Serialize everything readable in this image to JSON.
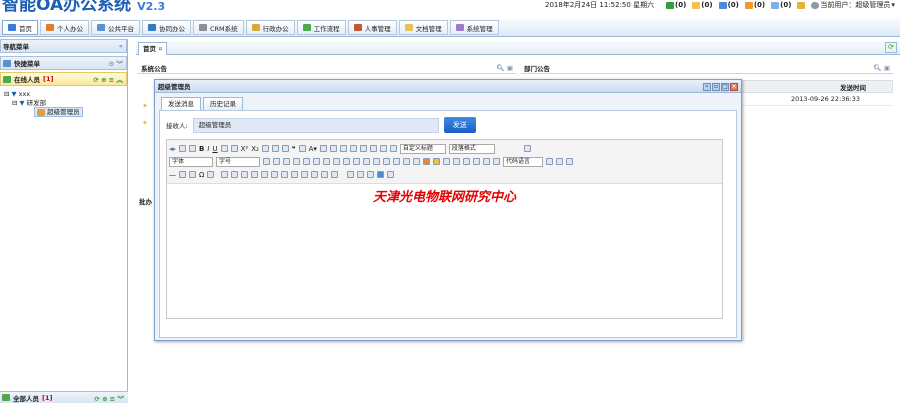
{
  "app": {
    "title": "智能OA办公系统",
    "version": "V2.3"
  },
  "header": {
    "datetime": "2018年2月24日 11:52:50 星期六",
    "tray": [
      "(0)",
      "(0)",
      "(0)",
      "(0)",
      "(0)"
    ],
    "current_user": "当前用户：超级管理员"
  },
  "nav": [
    "首页",
    "个人办公",
    "公共平台",
    "协同办公",
    "CRM系统",
    "行政办公",
    "工作流程",
    "人事管理",
    "文档管理",
    "系统管理"
  ],
  "sidebar": {
    "title": "导航菜单",
    "quick": "快捷菜单",
    "online": "在线人员",
    "online_count": "[1]",
    "tree": {
      "root": "xxx",
      "dept": "研发部",
      "user": "超级管理员"
    },
    "all": "全部人员",
    "all_count": "[1]"
  },
  "tabs": {
    "home": "首页"
  },
  "panels": {
    "notice": "系统公告",
    "dept_notice": "部门公告",
    "pending": "批办",
    "send_time_header": "发送时间",
    "send_time_value": "2013-09-26 22:36:33"
  },
  "dialog": {
    "title": "超级管理员",
    "tabs": [
      "发送消息",
      "历史记录"
    ],
    "recipient_label": "接收人:",
    "recipient_value": "超级管理员",
    "send_button": "发送",
    "toolbar": {
      "custom_title": "自定义标题",
      "para_format": "段落格式",
      "font": "字体",
      "size": "字号",
      "code_lang": "代码语言"
    },
    "content": "天津光电物联网研究中心"
  },
  "colors": {
    "accent": "#1a5fb4",
    "content_red": "#e60000",
    "send_btn": "#2a72d6"
  }
}
